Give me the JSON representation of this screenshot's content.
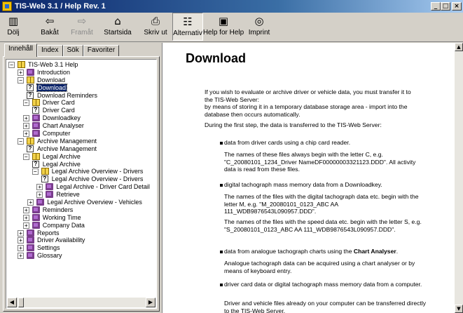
{
  "window": {
    "title": "TIS-Web 3.1 / Help Rev. 1",
    "controls": [
      "_",
      "□",
      "×"
    ]
  },
  "toolbar": [
    {
      "label": "Dölj",
      "icon": "▥",
      "state": "normal"
    },
    {
      "label": "Bakåt",
      "icon": "⇦",
      "state": "normal"
    },
    {
      "label": "Framåt",
      "icon": "⇨",
      "state": "disabled"
    },
    {
      "label": "Startsida",
      "icon": "⌂",
      "state": "normal"
    },
    {
      "label": "Skriv ut",
      "icon": "⎙",
      "state": "normal"
    },
    {
      "label": "Alternativ",
      "icon": "☷",
      "state": "pressed"
    },
    {
      "label": "Help for Help",
      "icon": "▣",
      "state": "normal"
    },
    {
      "label": "Imprint",
      "icon": "◎",
      "state": "normal"
    }
  ],
  "tabs": [
    {
      "label": "Innehåll",
      "active": true
    },
    {
      "label": "Index",
      "active": false
    },
    {
      "label": "Sök",
      "active": false
    },
    {
      "label": "Favoriter",
      "active": false
    }
  ],
  "tree": [
    {
      "label": "TIS-Web 3.1 Help",
      "level": 0,
      "type": "bookopen",
      "expander": "−"
    },
    {
      "label": "Introduction",
      "level": 1,
      "type": "book",
      "expander": "+"
    },
    {
      "label": "Download",
      "level": 1,
      "type": "bookopen",
      "expander": "−"
    },
    {
      "label": "Download",
      "level": 2,
      "type": "page",
      "selected": true
    },
    {
      "label": "Download Reminders",
      "level": 2,
      "type": "page"
    },
    {
      "label": "Driver Card",
      "level": 1.6,
      "type": "bookopen",
      "expander": "−"
    },
    {
      "label": "Driver Card",
      "level": 2.6,
      "type": "page"
    },
    {
      "label": "Downloadkey",
      "level": 1.6,
      "type": "book",
      "expander": "+"
    },
    {
      "label": "Chart Analyser",
      "level": 1.6,
      "type": "book",
      "expander": "+"
    },
    {
      "label": "Computer",
      "level": 1.6,
      "type": "book",
      "expander": "+"
    },
    {
      "label": "Archive Management",
      "level": 1,
      "type": "bookopen",
      "expander": "−"
    },
    {
      "label": "Archive Management",
      "level": 2,
      "type": "page"
    },
    {
      "label": "Legal Archive",
      "level": 1.6,
      "type": "bookopen",
      "expander": "−"
    },
    {
      "label": "Legal Archive",
      "level": 2.6,
      "type": "page"
    },
    {
      "label": "Legal Archive Overview - Drivers",
      "level": 2.6,
      "type": "bookopen",
      "expander": "−"
    },
    {
      "label": "Legal Archive Overview - Drivers",
      "level": 3.6,
      "type": "page"
    },
    {
      "label": "Legal Archive - Driver Card Detail",
      "level": 3.1,
      "type": "book",
      "expander": "+"
    },
    {
      "label": "Retrieve",
      "level": 3.1,
      "type": "book",
      "expander": "+"
    },
    {
      "label": "Legal Archive Overview - Vehicles",
      "level": 2.1,
      "type": "book",
      "expander": "+"
    },
    {
      "label": "Reminders",
      "level": 1.6,
      "type": "book",
      "expander": "+"
    },
    {
      "label": "Working Time",
      "level": 1.6,
      "type": "book",
      "expander": "+"
    },
    {
      "label": "Company Data",
      "level": 1.6,
      "type": "book",
      "expander": "+"
    },
    {
      "label": "Reports",
      "level": 1,
      "type": "book",
      "expander": "+"
    },
    {
      "label": "Driver Availability",
      "level": 1,
      "type": "book",
      "expander": "+"
    },
    {
      "label": "Settings",
      "level": 1,
      "type": "book",
      "expander": "+"
    },
    {
      "label": "Glossary",
      "level": 1,
      "type": "book",
      "expander": "+"
    }
  ],
  "content": {
    "heading": "Download",
    "intro1": "If you wish to evaluate or archive driver or vehicle data, you must transfer it to the TIS-Web Server:",
    "intro2": "by means of storing it in a temporary database storage area - import into the database then occurs automatically.",
    "intro3": "During the first step, the data is transferred to the TIS-Web Server:",
    "b1": "data from driver cards using a chip card reader.",
    "b1_sub": "The names of these files always begin with the letter C, e.g. \"C_20080101_1234_Driver NameDF00000003321123.DDD\". All activity data is read from these files.",
    "b2": "digital tachograph mass memory data from a Downloadkey.",
    "b2_sub1": "The names of the files with the digital tachograph data etc. begin with the letter M, e.g. \"M_20080101_0123_ABC AA 111_WDB9876543L090957.DDD\".",
    "b2_sub2": "The names of the files with the speed data etc. begin with the letter S, e.g. \"S_20080101_0123_ABC AA 111_WDB9876543L090957.DDD\".",
    "b3_pre": "data from analogue tachograph charts using the ",
    "b3_bold": "Chart Analyser",
    "b3_post": ".",
    "b3_sub": "Analogue tachograph data can be acquired using a chart analyser or by means of keyboard entry.",
    "b4": "driver card data or digital tachograph mass memory data from a computer.",
    "b4_sub": "Driver and vehicle files already on your computer can be transferred directly to the TIS-Web Server."
  }
}
